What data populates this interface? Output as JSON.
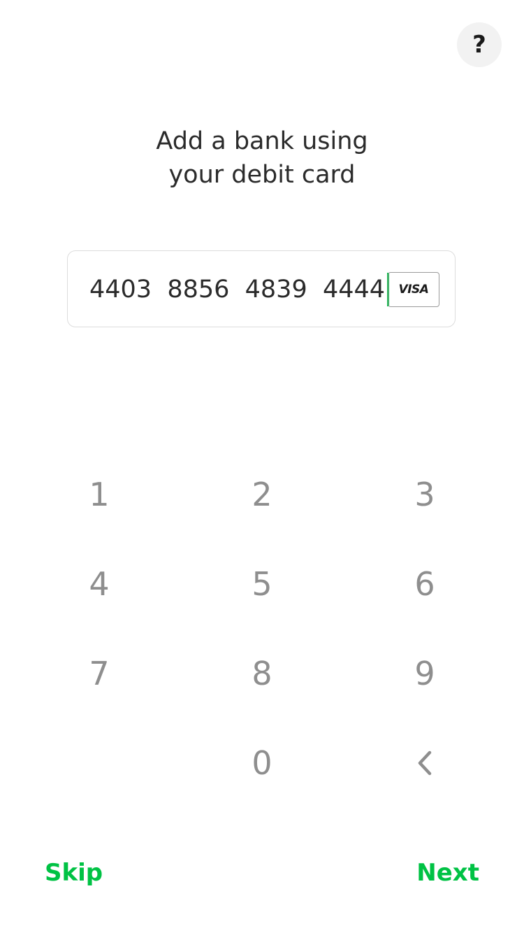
{
  "help": {
    "label": "?"
  },
  "heading": {
    "line1": "Add a bank using",
    "line2": "your debit card"
  },
  "card_input": {
    "value": "4403  8856  4839  4444",
    "brand": "VISA"
  },
  "keypad": {
    "keys": [
      "1",
      "2",
      "3",
      "4",
      "5",
      "6",
      "7",
      "8",
      "9",
      "",
      "0",
      "backspace"
    ],
    "backspace_icon": "chevron-left-icon"
  },
  "footer": {
    "skip_label": "Skip",
    "next_label": "Next"
  },
  "colors": {
    "accent": "#00c244",
    "keypad_text": "#8e8e8e",
    "heading_text": "#2b2b2b",
    "help_bg": "#f2f2f2"
  }
}
